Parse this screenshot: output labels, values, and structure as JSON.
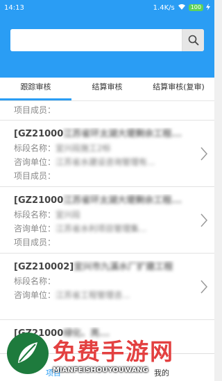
{
  "statusbar": {
    "time": "14:13",
    "network": "1.4K/s",
    "battery": "100"
  },
  "search": {
    "placeholder": "",
    "value": ""
  },
  "tabs": [
    {
      "label": "跟踪审核",
      "active": true
    },
    {
      "label": "结算审核",
      "active": false
    },
    {
      "label": "结算审核(复审)",
      "active": false
    }
  ],
  "partial_card": {
    "member_label": "项目成员："
  },
  "cards": [
    {
      "code": "[GZ21000",
      "title_tail": "江苏省环太湖大堤剩余工程...",
      "section_label": "标段名称：",
      "section_value": "宜兴段施工2标",
      "consult_label": "咨询单位：",
      "consult_value": "江苏省水建设咨询管理有...",
      "member_label": "项目成员："
    },
    {
      "code": "[GZ21000",
      "title_tail": "江苏省环太湖大堤剩余工程...",
      "section_label": "标段名称：",
      "section_value": "宜兴段",
      "consult_label": "咨询单位：",
      "consult_value": "江苏省水利项目管理集...",
      "member_label": "项目成员："
    },
    {
      "code": "[GZ210002]",
      "title_tail": "宜兴市九溪水厂扩建工程",
      "section_label": "标段名称：",
      "section_value": "",
      "consult_label": "咨询单位：",
      "consult_value": "江苏省工程管理咨...",
      "member_label": ""
    },
    {
      "code": "[GZ21000",
      "title_tail": "绿化、亮...",
      "section_label": "",
      "section_value": "",
      "consult_label": "",
      "consult_value": "",
      "member_label": ""
    }
  ],
  "bottom_nav": {
    "project_label": "项目",
    "me_label": "我的"
  },
  "watermark": {
    "big": "免费手游网",
    "small": "MIANFEISHOUYOUWANG"
  },
  "colors": {
    "primary": "#2a9df4",
    "watermark_red": "#e34040"
  }
}
